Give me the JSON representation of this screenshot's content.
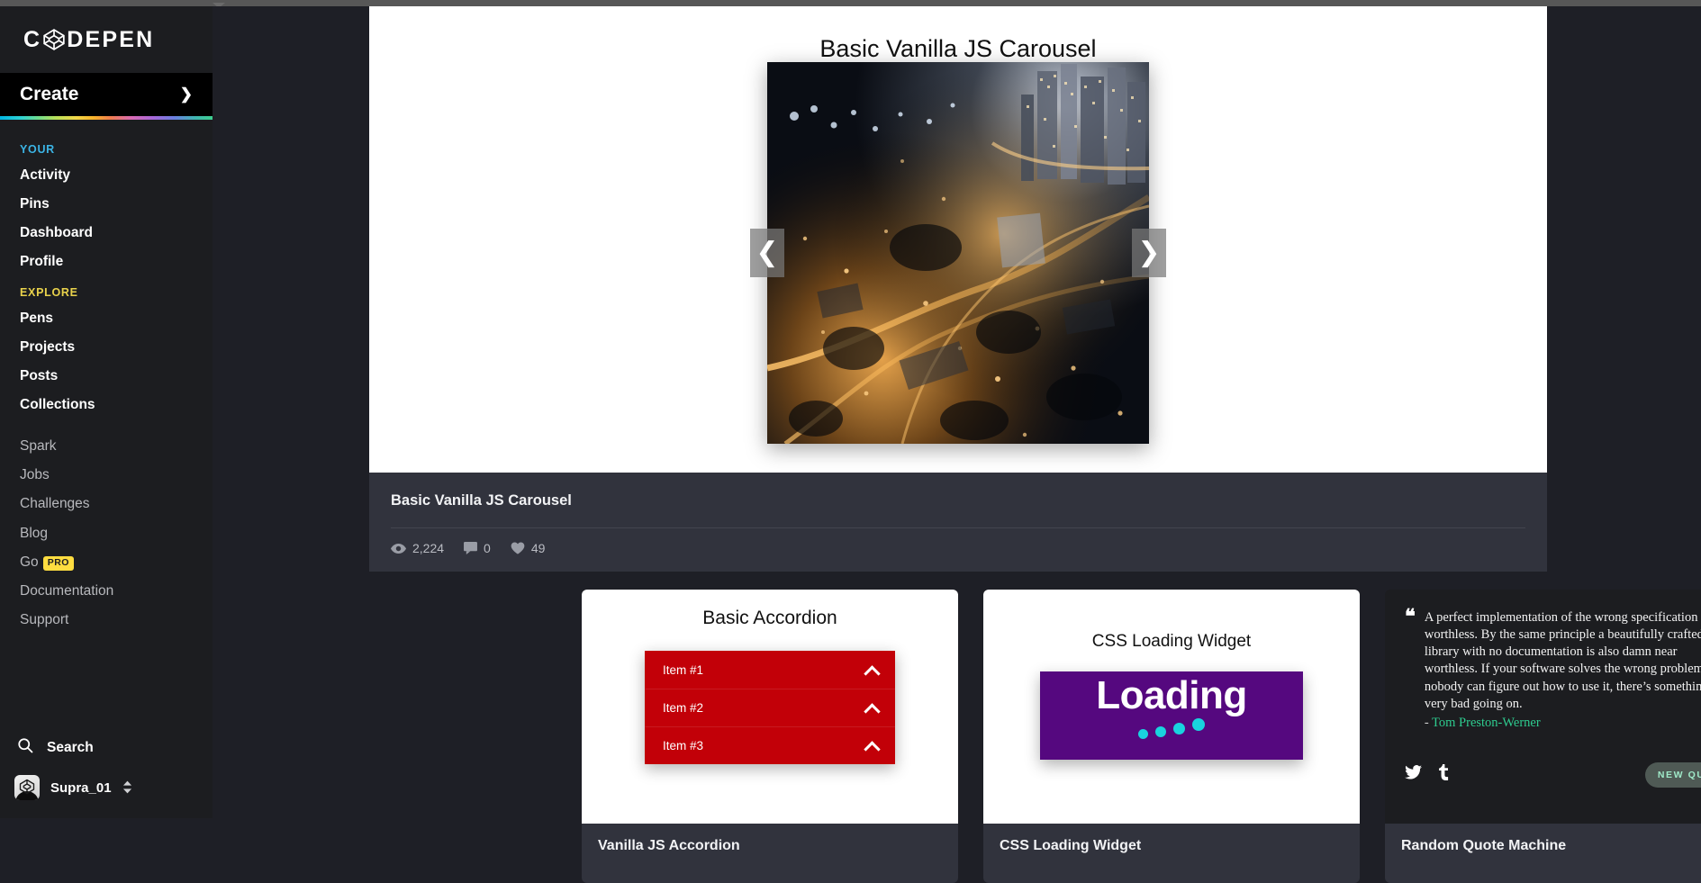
{
  "brand": {
    "name": "CODEPEN",
    "logo_icon": "codepen-logo-icon"
  },
  "sidebar": {
    "create": {
      "label": "Create",
      "icon": "chevron-right-icon"
    },
    "your_heading": "YOUR",
    "your_items": [
      {
        "label": "Activity"
      },
      {
        "label": "Pins"
      },
      {
        "label": "Dashboard"
      },
      {
        "label": "Profile"
      }
    ],
    "explore_heading": "EXPLORE",
    "explore_items": [
      {
        "label": "Pens"
      },
      {
        "label": "Projects"
      },
      {
        "label": "Posts"
      },
      {
        "label": "Collections"
      }
    ],
    "secondary_items": [
      {
        "label": "Spark",
        "badge": ""
      },
      {
        "label": "Jobs",
        "badge": ""
      },
      {
        "label": "Challenges",
        "badge": ""
      },
      {
        "label": "Blog",
        "badge": ""
      },
      {
        "label": "Go",
        "badge": "PRO"
      },
      {
        "label": "Documentation",
        "badge": ""
      },
      {
        "label": "Support",
        "badge": ""
      }
    ],
    "search": {
      "label": "Search",
      "icon": "search-icon"
    },
    "user": {
      "name": "Supra_01",
      "icon": "avatar",
      "sort_icon": "up-down-chevron-icon"
    }
  },
  "featured_pen": {
    "preview_title": "Basic Vanilla JS Carousel",
    "title": "Basic Vanilla JS Carousel",
    "carousel": {
      "prev_icon": "chevron-left-icon",
      "next_icon": "chevron-right-icon",
      "image_alt": "aerial night cityscape"
    },
    "stats": [
      {
        "icon": "eye-icon",
        "value": "2,224"
      },
      {
        "icon": "comment-icon",
        "value": "0"
      },
      {
        "icon": "heart-icon",
        "value": "49"
      }
    ]
  },
  "cards": [
    {
      "kind": "accordion",
      "preview_title": "Basic Accordion",
      "items": [
        {
          "label": "Item #1",
          "icon": "chevron-up-icon"
        },
        {
          "label": "Item #2",
          "icon": "chevron-up-icon"
        },
        {
          "label": "Item #3",
          "icon": "chevron-up-icon"
        }
      ],
      "foot_title": "Vanilla JS Accordion"
    },
    {
      "kind": "loading",
      "preview_title": "CSS Loading Widget",
      "loading_text": "Loading",
      "foot_title": "CSS Loading Widget"
    },
    {
      "kind": "quote",
      "quote_open": "“",
      "quote_close": "”",
      "quote_text": "A perfect implementation of the wrong specification is worthless. By the same principle a beautifully crafted library with no documentation is also damn near worthless. If your software solves the wrong problem or nobody can figure out how to use it, there’s something very bad going on.",
      "author_prefix": "- ",
      "author": "Tom Preston-Werner",
      "share": [
        {
          "icon": "twitter-icon"
        },
        {
          "icon": "tumblr-icon"
        }
      ],
      "new_quote_label": "NEW QUOTE",
      "foot_title": "Random Quote Machine"
    }
  ],
  "colors": {
    "sidebar_bg": "#1c1d20",
    "main_bg": "#1e1f26",
    "card_foot_bg": "#31333d",
    "accent_your": "#3bb4e5",
    "accent_explore": "#e9d24b",
    "pro_badge": "#ffdd40",
    "accordion_red": "#c20008",
    "loading_purple": "#55087f",
    "loading_dot": "#19d3de",
    "quote_author": "#2ecc8f"
  }
}
